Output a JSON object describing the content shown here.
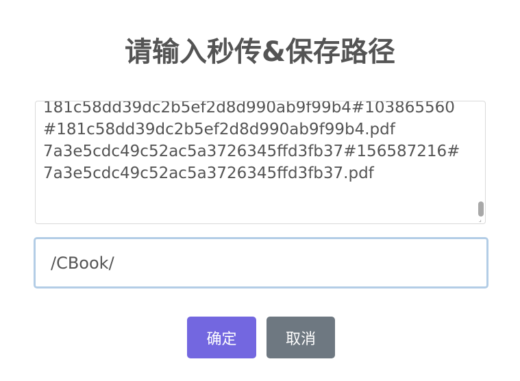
{
  "dialog": {
    "title": "请输入秒传&保存路径",
    "textarea": {
      "value": "181c58dd39dc2b5ef2d8d990ab9f99b4#103865560#181c58dd39dc2b5ef2d8d990ab9f99b4.pdf\n7a3e5cdc49c52ac5a3726345ffd3fb37#156587216#7a3e5cdc49c52ac5a3726345ffd3fb37.pdf"
    },
    "path_input": {
      "value": "/CBook/"
    },
    "buttons": {
      "confirm_label": "确定",
      "cancel_label": "取消"
    },
    "colors": {
      "confirm": "#7367e0",
      "cancel": "#6e7881",
      "input_focus_border": "#b3cde6",
      "text": "#545454"
    }
  }
}
